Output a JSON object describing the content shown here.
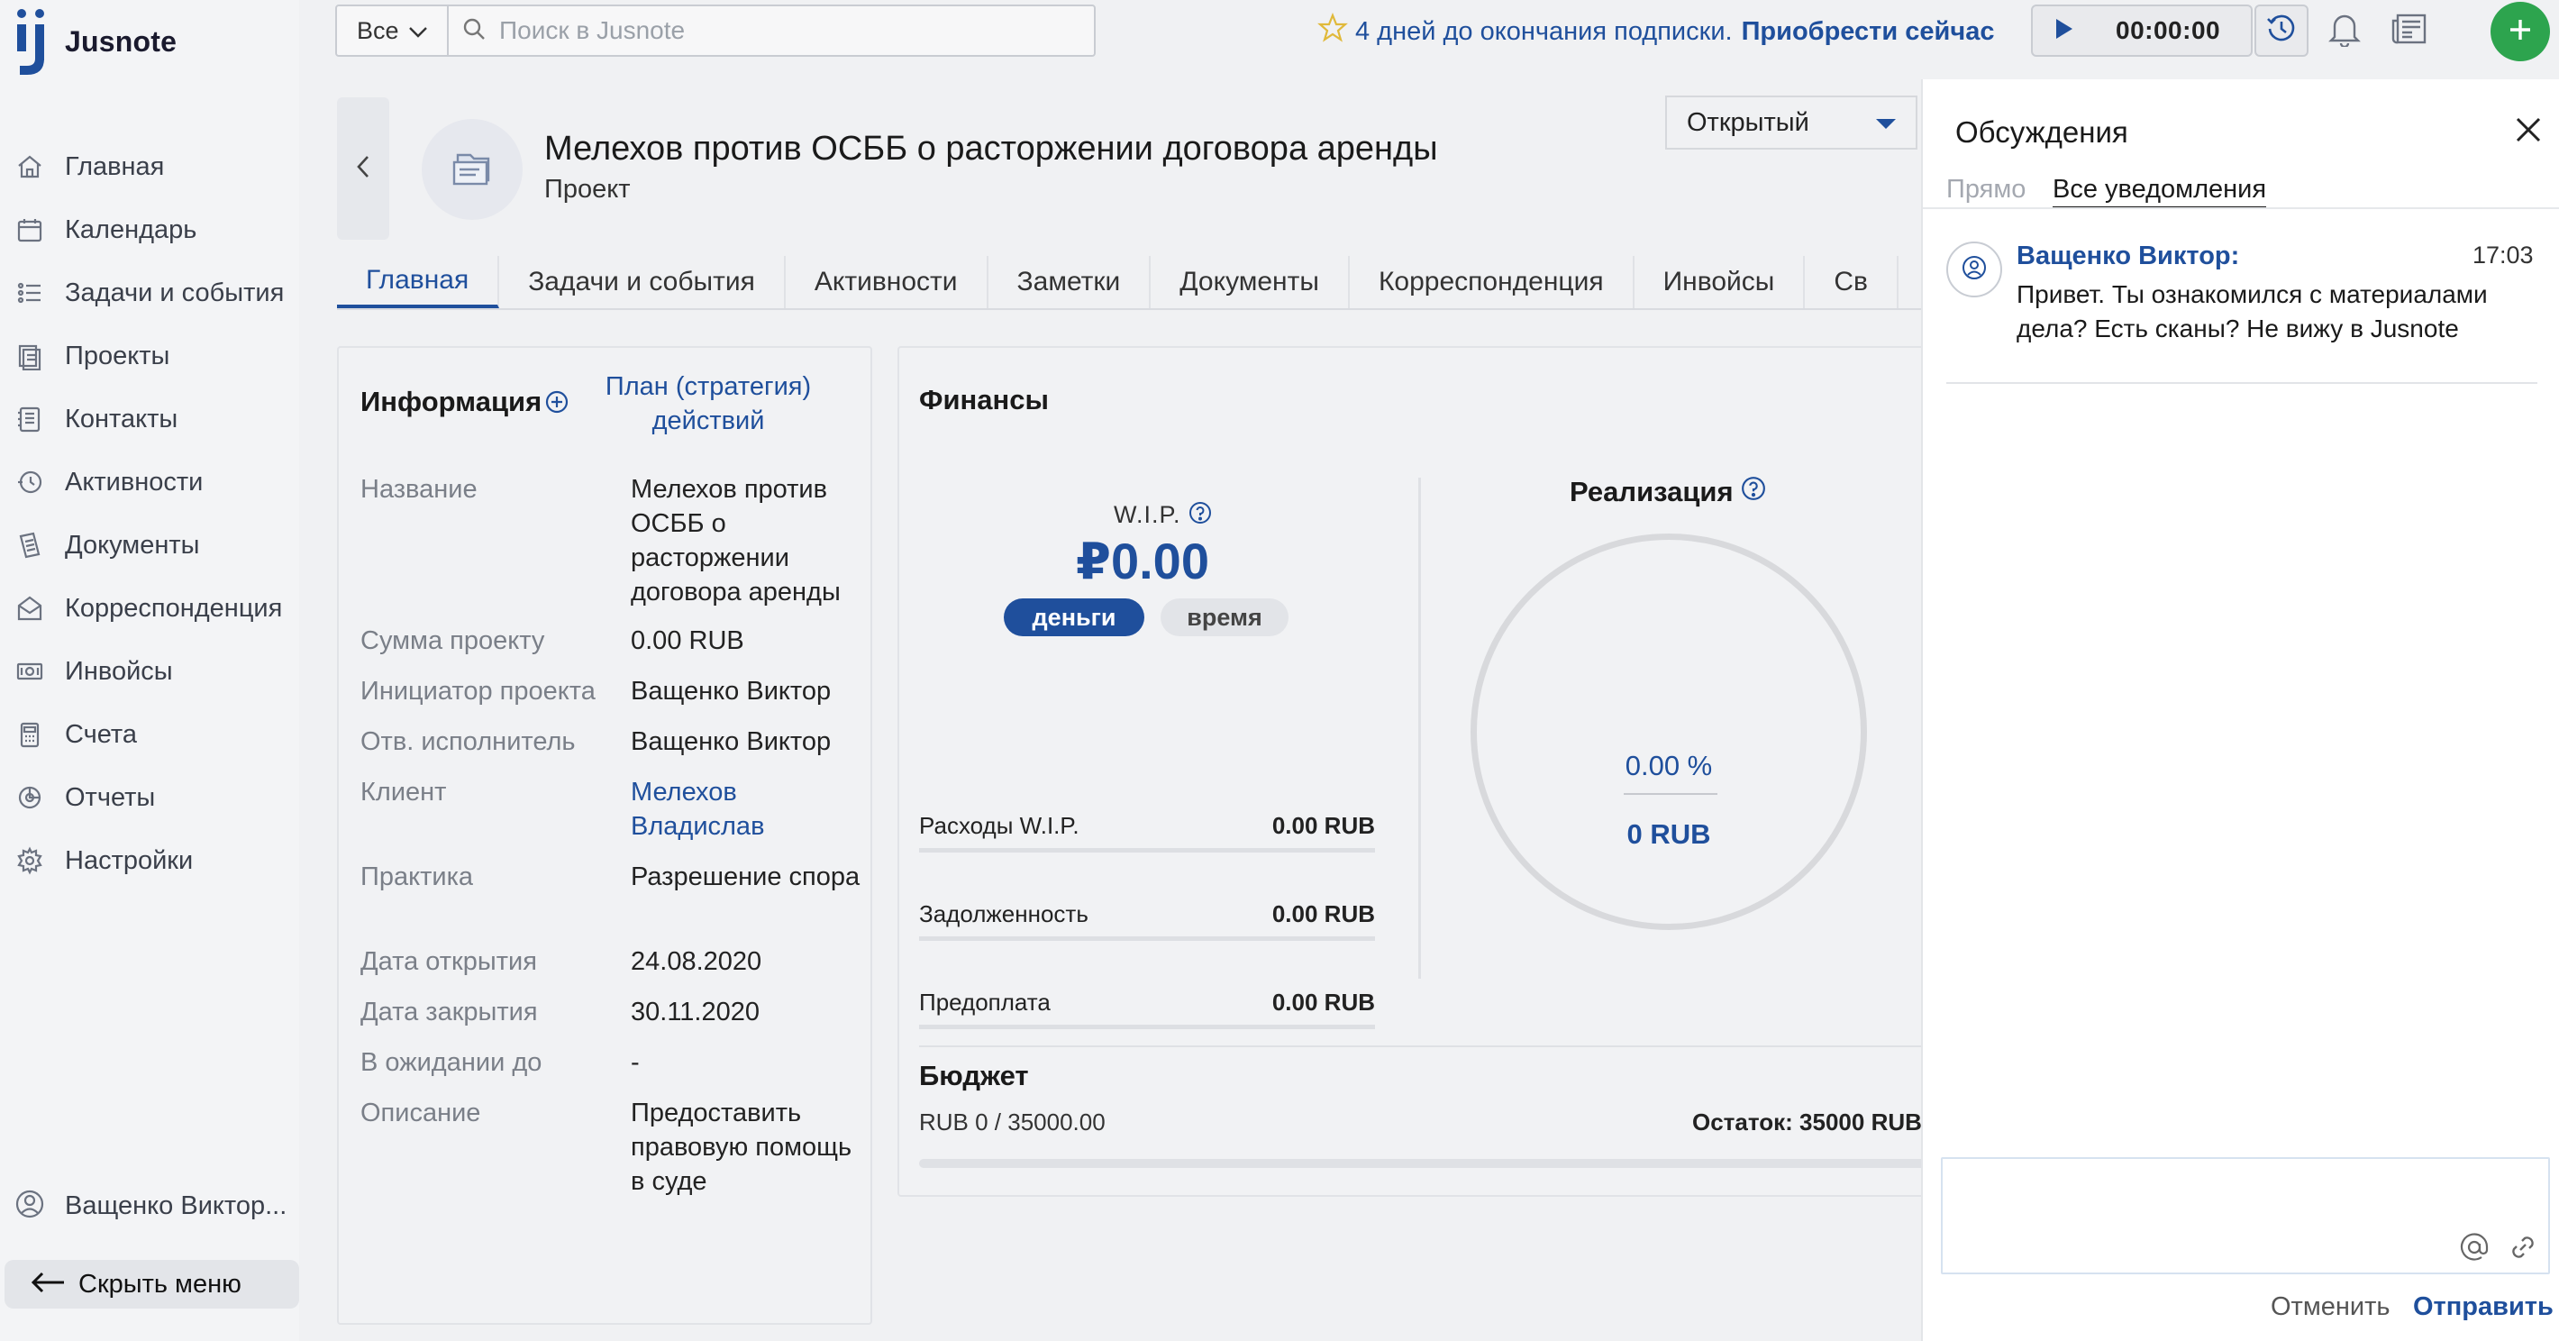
{
  "brand": {
    "name": "Jusnote"
  },
  "sidebar": {
    "items": [
      {
        "label": "Главная",
        "icon": "home-icon"
      },
      {
        "label": "Календарь",
        "icon": "calendar-icon"
      },
      {
        "label": "Задачи и события",
        "icon": "tasks-icon"
      },
      {
        "label": "Проекты",
        "icon": "projects-icon"
      },
      {
        "label": "Контакты",
        "icon": "contacts-icon"
      },
      {
        "label": "Активности",
        "icon": "activities-icon"
      },
      {
        "label": "Документы",
        "icon": "documents-icon"
      },
      {
        "label": "Корреспонденция",
        "icon": "mail-icon"
      },
      {
        "label": "Инвойсы",
        "icon": "invoice-icon"
      },
      {
        "label": "Счета",
        "icon": "accounts-icon"
      },
      {
        "label": "Отчеты",
        "icon": "reports-icon"
      },
      {
        "label": "Настройки",
        "icon": "settings-icon"
      }
    ],
    "user": "Ващенко Виктор...",
    "hide_menu": "Скрыть меню"
  },
  "topbar": {
    "scope": "Все",
    "search_placeholder": "Поиск в Jusnote",
    "subscription_text": "4 дней до окончания подписки.",
    "subscription_link": "Приобрести сейчас",
    "timer": "00:00:00"
  },
  "project": {
    "title": "Мелехов против ОСББ о расторжении договора аренды",
    "subtitle": "Проект",
    "status": "Открытый"
  },
  "tabs": [
    "Главная",
    "Задачи и события",
    "Активности",
    "Заметки",
    "Документы",
    "Корреспонденция",
    "Инвойсы",
    "Св"
  ],
  "info": {
    "title": "Информация",
    "plan_link": "План (стратегия) действий",
    "fields": [
      {
        "k": "Название",
        "v": "Мелехов против ОСББ о расторжении договора аренды"
      },
      {
        "k": "Сумма проекту",
        "v": "0.00 RUB"
      },
      {
        "k": "Инициатор проекта",
        "v": "Ващенко Виктор"
      },
      {
        "k": "Отв. исполнитель",
        "v": "Ващенко Виктор"
      },
      {
        "k": "Клиент",
        "v": "Мелехов Владислав"
      },
      {
        "k": "Практика",
        "v": "Разрешение спора"
      },
      {
        "k": "Дата открытия",
        "v": "24.08.2020"
      },
      {
        "k": "Дата закрытия",
        "v": "30.11.2020"
      },
      {
        "k": "В ожидании до",
        "v": "-"
      },
      {
        "k": "Описание",
        "v": "Предоставить правовую помощь в суде"
      }
    ]
  },
  "finance": {
    "title": "Финансы",
    "wip_label": "W.I.P.",
    "wip_amount": "₽0.00",
    "pill_money": "деньги",
    "pill_time": "время",
    "rows": [
      {
        "k": "Расходы W.I.P.",
        "v": "0.00 RUB"
      },
      {
        "k": "Задолженность",
        "v": "0.00 RUB"
      },
      {
        "k": "Предоплата",
        "v": "0.00 RUB"
      }
    ],
    "realization_title": "Реализация",
    "realization_pct": "0.00 %",
    "realization_rub": "0 RUB",
    "budget_title": "Бюджет",
    "budget_used": "RUB 0 / 35000.00",
    "budget_left": "Остаток: 35000 RUB",
    "budget_fraction": 0
  },
  "discussion": {
    "title": "Обсуждения",
    "tab_direct": "Прямо",
    "tab_all": "Все уведомления",
    "message": {
      "author": "Ващенко Виктор:",
      "time": "17:03",
      "text": "Привет. Ты ознакомился с материалами дела? Есть сканы? Не вижу в Jusnote"
    },
    "cancel": "Отменить",
    "send": "Отправить"
  },
  "colors": {
    "accent": "#1f4f9c",
    "add_button": "#2da44e",
    "star": "#e0b93a"
  }
}
